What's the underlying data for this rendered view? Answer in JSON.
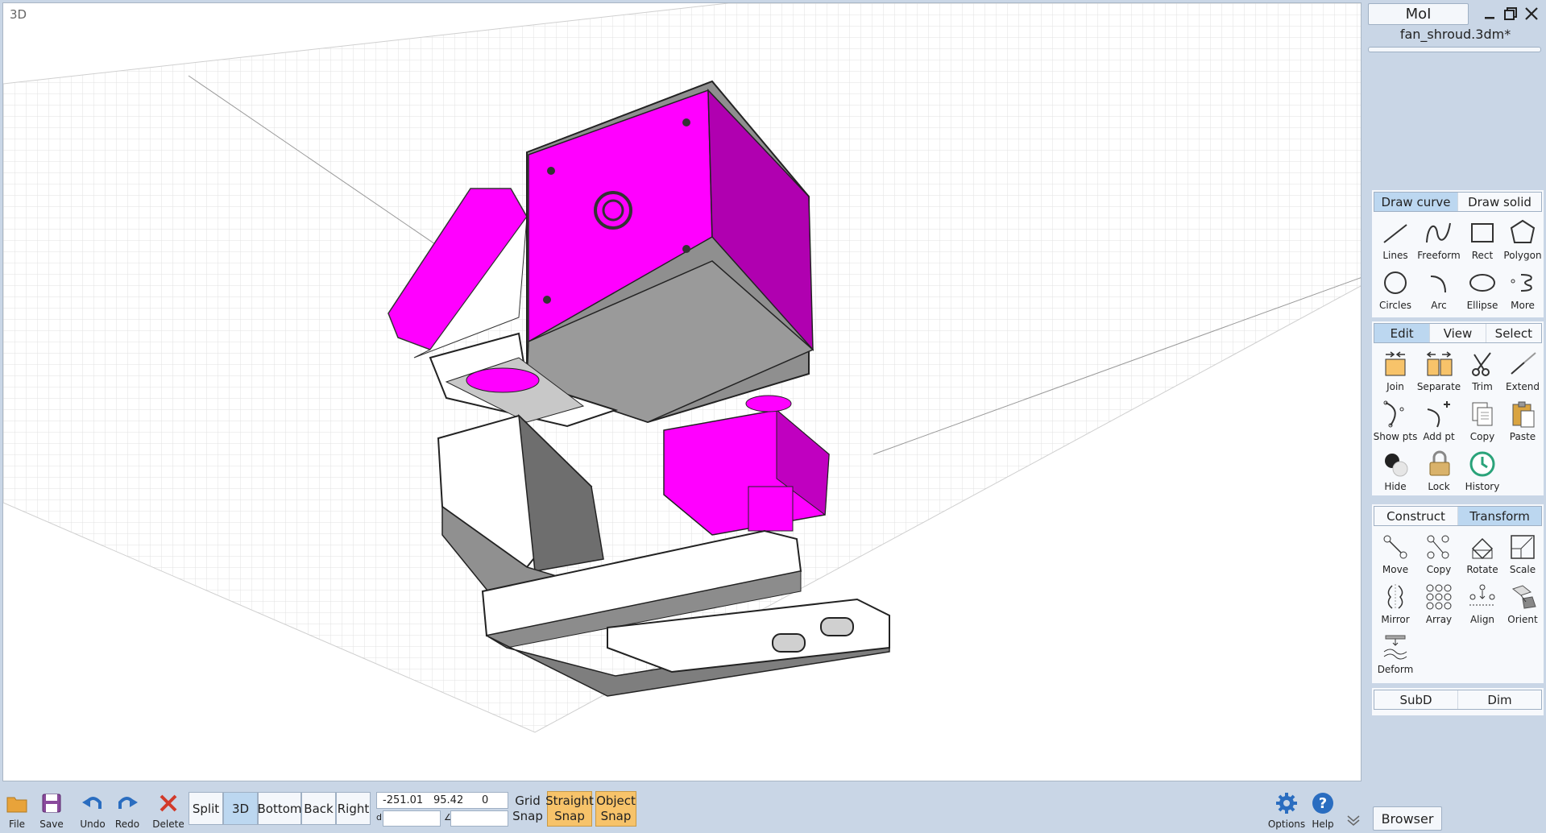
{
  "viewport": {
    "label": "3D"
  },
  "window": {
    "app_name": "MoI",
    "file_name": "fan_shroud.3dm*",
    "minimize_icon": "minimize-icon",
    "restore_icon": "restore-icon",
    "close_icon": "close-icon"
  },
  "draw": {
    "tabs": [
      {
        "label": "Draw curve",
        "active": true
      },
      {
        "label": "Draw solid",
        "active": false
      }
    ],
    "tools": [
      {
        "label": "Lines",
        "icon": "line-icon"
      },
      {
        "label": "Freeform",
        "icon": "freeform-icon"
      },
      {
        "label": "Rect",
        "icon": "rect-icon"
      },
      {
        "label": "Polygon",
        "icon": "polygon-icon"
      },
      {
        "label": "Circles",
        "icon": "circle-icon"
      },
      {
        "label": "Arc",
        "icon": "arc-icon"
      },
      {
        "label": "Ellipse",
        "icon": "ellipse-icon"
      },
      {
        "label": "More",
        "icon": "more-icon"
      }
    ]
  },
  "edit": {
    "tabs": [
      {
        "label": "Edit",
        "active": true
      },
      {
        "label": "View",
        "active": false
      },
      {
        "label": "Select",
        "active": false
      }
    ],
    "tools": [
      {
        "label": "Join",
        "icon": "join-icon"
      },
      {
        "label": "Separate",
        "icon": "separate-icon"
      },
      {
        "label": "Trim",
        "icon": "scissors-icon"
      },
      {
        "label": "Extend",
        "icon": "extend-icon"
      },
      {
        "label": "Show pts",
        "icon": "show-points-icon"
      },
      {
        "label": "Add pt",
        "icon": "add-point-icon"
      },
      {
        "label": "Copy",
        "icon": "copy-icon"
      },
      {
        "label": "Paste",
        "icon": "paste-icon"
      },
      {
        "label": "Hide",
        "icon": "hide-icon"
      },
      {
        "label": "Lock",
        "icon": "lock-icon"
      },
      {
        "label": "History",
        "icon": "history-icon"
      }
    ]
  },
  "transform": {
    "tabs": [
      {
        "label": "Construct",
        "active": false
      },
      {
        "label": "Transform",
        "active": true
      }
    ],
    "tools": [
      {
        "label": "Move",
        "icon": "move-icon"
      },
      {
        "label": "Copy",
        "icon": "copy-transform-icon"
      },
      {
        "label": "Rotate",
        "icon": "rotate-icon"
      },
      {
        "label": "Scale",
        "icon": "scale-icon"
      },
      {
        "label": "Mirror",
        "icon": "mirror-icon"
      },
      {
        "label": "Array",
        "icon": "array-icon"
      },
      {
        "label": "Align",
        "icon": "align-icon"
      },
      {
        "label": "Orient",
        "icon": "orient-icon"
      },
      {
        "label": "Deform",
        "icon": "deform-icon"
      }
    ]
  },
  "extra": {
    "tabs": [
      {
        "label": "SubD"
      },
      {
        "label": "Dim"
      }
    ]
  },
  "bottom": {
    "file": {
      "label": "File",
      "icon": "folder-icon"
    },
    "save": {
      "label": "Save",
      "icon": "save-icon"
    },
    "undo": {
      "label": "Undo",
      "icon": "undo-icon"
    },
    "redo": {
      "label": "Redo",
      "icon": "redo-icon"
    },
    "delete": {
      "label": "Delete",
      "icon": "delete-icon"
    },
    "views": [
      {
        "label": "Split",
        "active": false
      },
      {
        "label": "3D",
        "active": true
      },
      {
        "label": "Bottom",
        "active": false
      },
      {
        "label": "Back",
        "active": false
      },
      {
        "label": "Right",
        "active": false
      }
    ],
    "coords": {
      "x": "-251.01",
      "y": "95.42",
      "z": "0",
      "d_label": "d",
      "angle_label": "∠"
    },
    "grid_snap": "Grid Snap",
    "straight_snap": "Straight Snap",
    "object_snap": "Object Snap",
    "options": {
      "label": "Options",
      "icon": "gear-icon"
    },
    "help": {
      "label": "Help",
      "icon": "help-icon"
    },
    "browser_label": "Browser"
  },
  "colors": {
    "accent_tab": "#bcd7f0",
    "snap_on": "#f7c36a",
    "model_magenta": "#ff00ff",
    "panel_bg": "#c9d6e6"
  }
}
